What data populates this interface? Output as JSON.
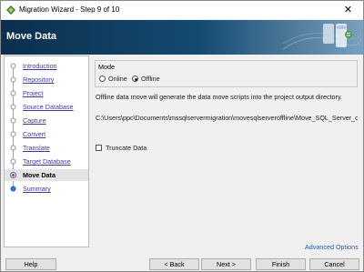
{
  "window": {
    "title": "Migration Wizard - Step 9 of 10",
    "close_glyph": "✕"
  },
  "header": {
    "title": "Move Data"
  },
  "steps": [
    {
      "label": "Introduction",
      "state": "done"
    },
    {
      "label": "Repository",
      "state": "done"
    },
    {
      "label": "Project",
      "state": "done"
    },
    {
      "label": "Source Database",
      "state": "done"
    },
    {
      "label": "Capture",
      "state": "done"
    },
    {
      "label": "Convert",
      "state": "done"
    },
    {
      "label": "Translate",
      "state": "done"
    },
    {
      "label": "Target Database",
      "state": "done"
    },
    {
      "label": "Move Data",
      "state": "current"
    },
    {
      "label": "Summary",
      "state": "pending"
    }
  ],
  "mode": {
    "legend": "Mode",
    "options": [
      {
        "label": "Online",
        "checked": false
      },
      {
        "label": "Offline",
        "checked": true
      }
    ]
  },
  "info_text": "Offline data move will generate the  data move scripts into the project output directory.",
  "output_path": "C:\\Users\\ppc\\Documents\\mssqlservermigration\\movesqlserveroffline\\Move_SQL_Server_offline",
  "truncate": {
    "label": "Truncate Data",
    "checked": false
  },
  "advanced_link": "Advanced Options",
  "buttons": {
    "help": "Help",
    "back": "< Back",
    "next": "Next >",
    "finish": "Finish",
    "cancel": "Cancel"
  },
  "colors": {
    "header_dark": "#0b2f4e",
    "link": "#3d3d9a",
    "advanced_link": "#1d5fae"
  }
}
